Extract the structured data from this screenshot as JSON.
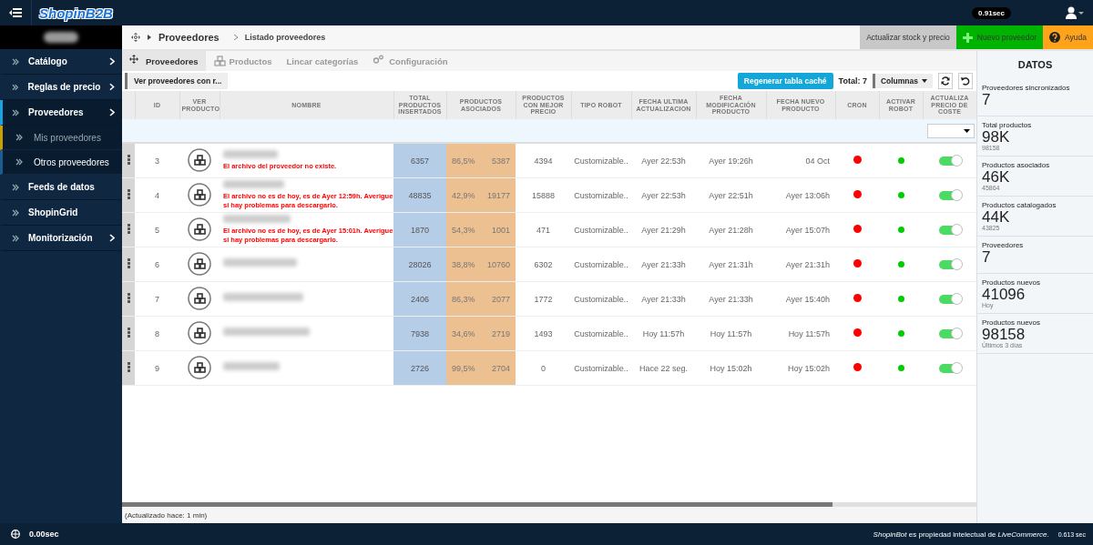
{
  "topbar": {
    "logo": "ShopinB2B",
    "timer": "0.91sec"
  },
  "sidebar": {
    "items": [
      {
        "label": "Catálogo",
        "selected": false,
        "has_submenu": true
      },
      {
        "label": "Reglas de precio",
        "selected": false,
        "has_submenu": true
      },
      {
        "label": "Proveedores",
        "selected": true,
        "has_submenu": true,
        "expanded": true,
        "children": [
          {
            "label": "Mis proveedores",
            "selected": true
          },
          {
            "label": "Otros proveedores",
            "selected": false
          }
        ]
      },
      {
        "label": "Feeds de datos",
        "selected": false,
        "has_submenu": false
      },
      {
        "label": "ShopinGrid",
        "selected": false,
        "has_submenu": false
      },
      {
        "label": "Monitorización",
        "selected": false,
        "has_submenu": true
      }
    ]
  },
  "breadcrumb": [
    "Proveedores",
    "Listado proveedores"
  ],
  "actions": [
    {
      "label": "Actualizar stock y precio",
      "kind": "plain"
    },
    {
      "label": "Nuevo proveedor",
      "kind": "add"
    },
    {
      "label": "Ayuda",
      "kind": "help"
    }
  ],
  "tabs": [
    {
      "label": "Proveedores",
      "selected": true,
      "kind": "move"
    },
    {
      "label": "Productos",
      "selected": false,
      "kind": "cubes"
    },
    {
      "label": "Lincar categorías",
      "selected": false,
      "kind": "none"
    },
    {
      "label": "Configuración",
      "selected": false,
      "kind": "gears"
    }
  ],
  "toolbar": {
    "filter_button": "Ver proveedores con r...",
    "regen_button": "Regenerar tabla caché",
    "total": "Total: 7",
    "columns_button": "Columnas"
  },
  "table": {
    "columns": [
      "ID",
      "VER PRODUCTO",
      "NOMBRE",
      "TOTAL PRODUCTOS INSERTADOS",
      "PRODUCTOS ASOCIADOS",
      "PRODUCTOS CON MEJOR PRECIO",
      "TIPO ROBOT",
      "FECHA ULTIMA ACTUALIZACION",
      "FECHA MODIFICACIÓN PRODUCTO",
      "FECHA NUEVO PRODUCTO",
      "CRON",
      "ACTIVAR ROBOT",
      "ACTUALIZA PRECIO DE COSTE"
    ],
    "rows": [
      {
        "id": "3",
        "error": "El archivo del proveedor no existe.",
        "total": "6357",
        "pct": "86,5%",
        "asociados": "5387",
        "mejor": "4394",
        "tipo": "Customizable..",
        "f_actualizacion": "Ayer 22:53h",
        "f_modificacion": "Ayer 19:26h",
        "f_nuevo": "04 Oct",
        "cron": {
          "color": "#ff0000"
        },
        "robot": {
          "color": "#00cc00"
        },
        "cost_update_on": true
      },
      {
        "id": "4",
        "error": "El archivo no es de hoy, es de Ayer 12:59h. Averigue si hay problemas para descargarlo.",
        "total": "48835",
        "pct": "42,9%",
        "asociados": "19177",
        "mejor": "15888",
        "tipo": "Customizable..",
        "f_actualizacion": "Ayer 22:53h",
        "f_modificacion": "Ayer 22:51h",
        "f_nuevo": "Ayer 13:06h",
        "cron": {
          "color": "#ff0000"
        },
        "robot": {
          "color": "#00cc00"
        },
        "cost_update_on": true
      },
      {
        "id": "5",
        "error": "El archivo no es de hoy, es de Ayer 15:01h. Averigue si hay problemas para descargarlo.",
        "total": "1870",
        "pct": "54,3%",
        "asociados": "1001",
        "mejor": "471",
        "tipo": "Customizable..",
        "f_actualizacion": "Ayer 21:29h",
        "f_modificacion": "Ayer 21:28h",
        "f_nuevo": "Ayer 15:07h",
        "cron": {
          "color": "#ff0000"
        },
        "robot": {
          "color": "#00cc00"
        },
        "cost_update_on": true
      },
      {
        "id": "6",
        "total": "28026",
        "pct": "38,8%",
        "asociados": "10760",
        "mejor": "6302",
        "tipo": "Customizable..",
        "f_actualizacion": "Ayer 21:33h",
        "f_modificacion": "Ayer 21:31h",
        "f_nuevo": "Ayer 21:31h",
        "cron": {
          "color": "#ff0000"
        },
        "robot": {
          "color": "#00cc00"
        },
        "cost_update_on": true
      },
      {
        "id": "7",
        "total": "2406",
        "pct": "86,3%",
        "asociados": "2077",
        "mejor": "1772",
        "tipo": "Customizable..",
        "f_actualizacion": "Ayer 21:33h",
        "f_modificacion": "Ayer 21:33h",
        "f_nuevo": "Ayer 15:40h",
        "cron": {
          "color": "#ff0000"
        },
        "robot": {
          "color": "#00cc00"
        },
        "cost_update_on": true
      },
      {
        "id": "8",
        "total": "7938",
        "pct": "34,6%",
        "asociados": "2719",
        "mejor": "1493",
        "tipo": "Customizable..",
        "f_actualizacion": "Hoy 11:57h",
        "f_modificacion": "Hoy 11:57h",
        "f_nuevo": "Hoy 11:57h",
        "cron": {
          "color": "#ff0000"
        },
        "robot": {
          "color": "#00cc00"
        },
        "cost_update_on": true
      },
      {
        "id": "9",
        "total": "2726",
        "pct": "99,5%",
        "asociados": "2704",
        "mejor": "0",
        "tipo": "Customizable..",
        "f_actualizacion": "Hace 22 seg.",
        "f_modificacion": "Hoy 15:02h",
        "f_nuevo": "Hoy 15:02h",
        "cron": {
          "color": "#ff0000"
        },
        "robot": {
          "color": "#00cc00"
        },
        "cost_update_on": true
      }
    ]
  },
  "updated": "(Actualizado hace: 1 min)",
  "datos": {
    "title": "DATOS",
    "stats": [
      {
        "label": "Proveedores sincronizados",
        "value": "7"
      },
      {
        "label": "Total productos",
        "value": "98K",
        "sub": "98158"
      },
      {
        "label": "Productos asociados",
        "value": "46K",
        "sub": "45864"
      },
      {
        "label": "Productos catalogados",
        "value": "44K",
        "sub": "43825"
      },
      {
        "label": "Proveedores",
        "value": "7"
      },
      {
        "label": "Productos nuevos",
        "value": "41096",
        "sub": "Hoy"
      },
      {
        "label": "Productos nuevos",
        "value": "98158",
        "sub": "Últimos 3 días"
      }
    ]
  },
  "footer": {
    "timer": "0.00sec",
    "copyright": "*ShopinBot* es propiedad intelectual de *LiveCommerce*.",
    "render_time": "0.613 sec"
  }
}
